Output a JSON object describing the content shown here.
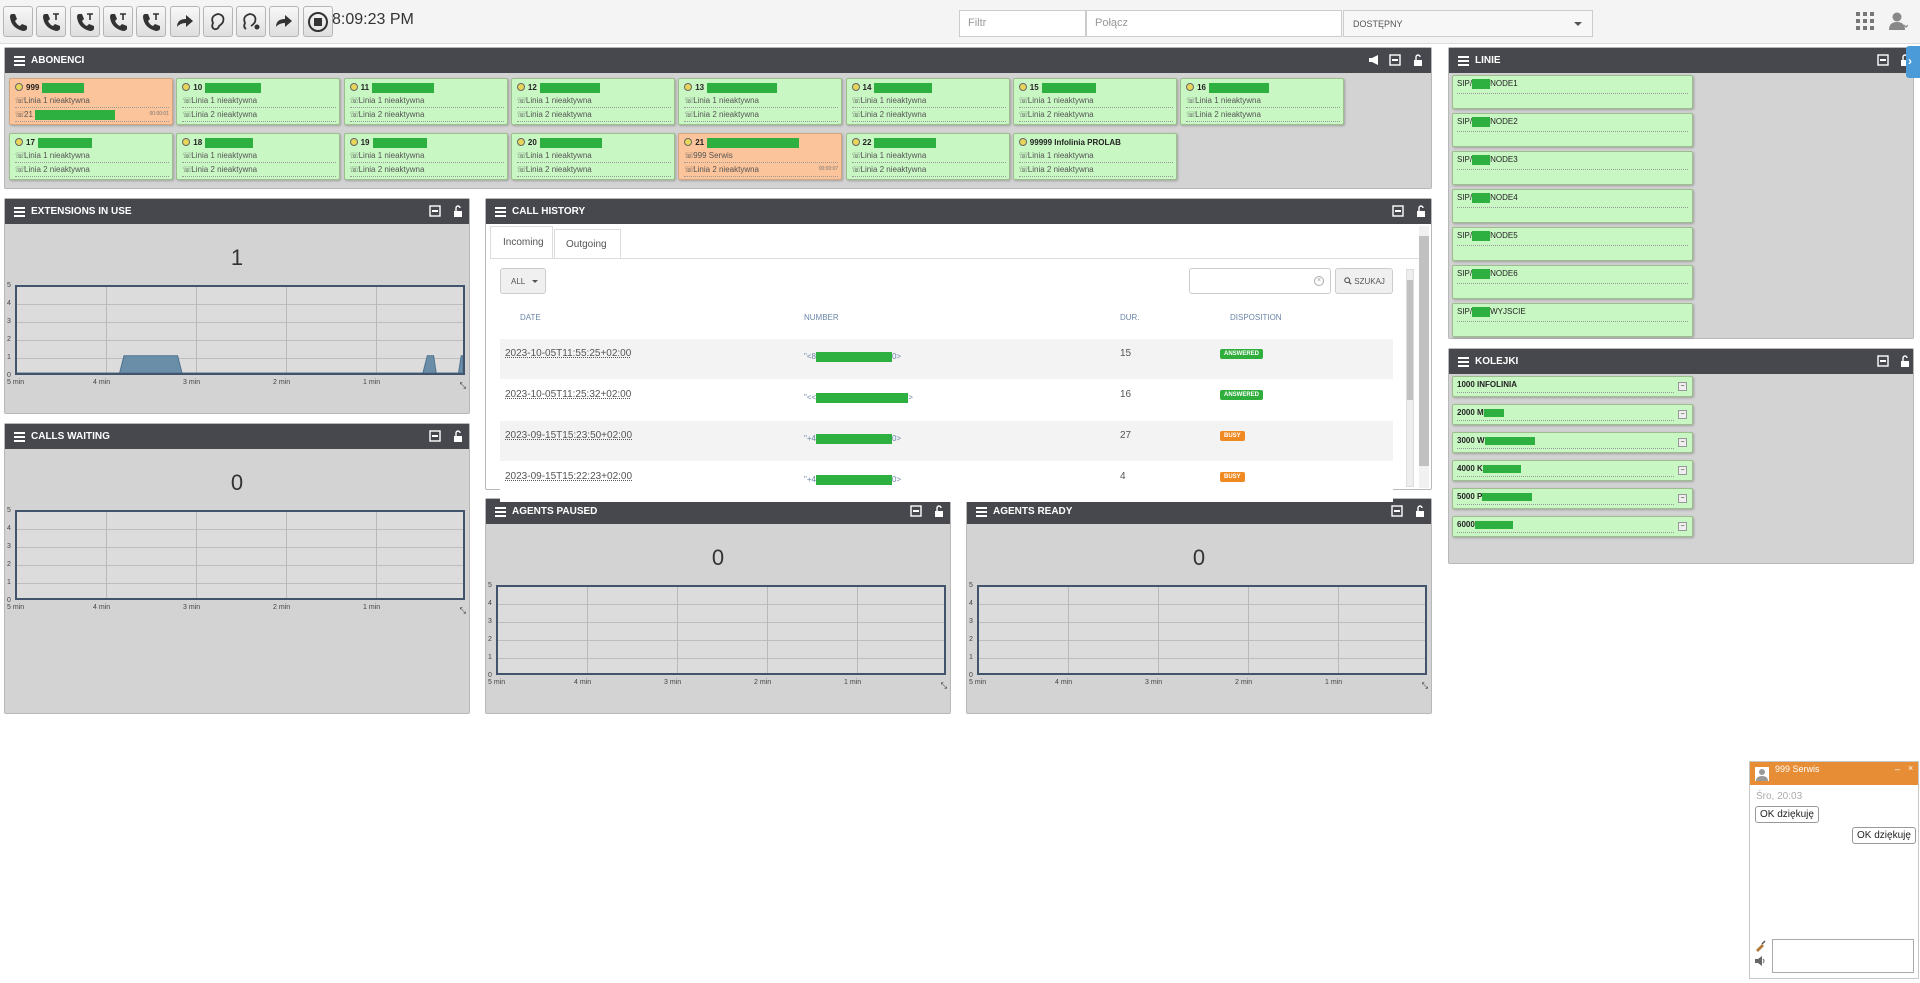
{
  "toolbar": {
    "clock": "8:09:23 PM",
    "filter_placeholder": "Filtr",
    "connect_placeholder": "Połącz",
    "status": "DOSTĘPNY",
    "buttons": [
      "phone-icon",
      "phone-transfer-icon",
      "phone-conference-icon",
      "phone-voicemail-icon",
      "phone-record-icon",
      "call-forward-icon",
      "ear-icon",
      "spy-icon",
      "call-redirect-icon",
      "stop-icon"
    ]
  },
  "abonenci": {
    "title": "ABONENCI",
    "cards": [
      {
        "num": "999",
        "line1": "Linia 1 nieaktywna",
        "line2": "21",
        "time": "00:00:01",
        "color": "orange",
        "r": 42,
        "r2": 80
      },
      {
        "num": "10",
        "line1": "Linia 1 nieaktywna",
        "line2": "Linia 2 nieaktywna",
        "color": "green",
        "r": 56
      },
      {
        "num": "11",
        "line1": "Linia 1 nieaktywna",
        "line2": "Linia 2 nieaktywna",
        "color": "green",
        "r": 62
      },
      {
        "num": "12",
        "line1": "Linia 1 nieaktywna",
        "line2": "Linia 2 nieaktywna",
        "color": "green",
        "r": 60
      },
      {
        "num": "13",
        "line1": "Linia 1 nieaktywna",
        "line2": "Linia 2 nieaktywna",
        "color": "green",
        "r": 70
      },
      {
        "num": "14",
        "line1": "Linia 1 nieaktywna",
        "line2": "Linia 2 nieaktywna",
        "color": "green",
        "r": 58
      },
      {
        "num": "15",
        "line1": "Linia 1 nieaktywna",
        "line2": "Linia 2 nieaktywna",
        "color": "green",
        "r": 54
      },
      {
        "num": "16",
        "line1": "Linia 1 nieaktywna",
        "line2": "Linia 2 nieaktywna",
        "color": "green",
        "r": 60
      },
      {
        "num": "17",
        "line1": "Linia 1 nieaktywna",
        "line2": "Linia 2 nieaktywna",
        "color": "green",
        "r": 54
      },
      {
        "num": "18",
        "line1": "Linia 1 nieaktywna",
        "line2": "Linia 2 nieaktywna",
        "color": "green",
        "r": 48
      },
      {
        "num": "19",
        "line1": "Linia 1 nieaktywna",
        "line2": "Linia 2 nieaktywna",
        "color": "green",
        "r": 54
      },
      {
        "num": "20",
        "line1": "Linia 1 nieaktywna",
        "line2": "Linia 2 nieaktywna",
        "color": "green",
        "r": 62
      },
      {
        "num": "21",
        "line1": "999 Serwis",
        "line2": "Linia 2 nieaktywna",
        "time": "00:00:07",
        "color": "orange",
        "r": 92
      },
      {
        "num": "22",
        "line1": "Linia 1 nieaktywna",
        "line2": "Linia 2 nieaktywna",
        "color": "green",
        "r": 62
      },
      {
        "num": "99999 Infolinia PROLAB",
        "line1": "Linia 1 nieaktywna",
        "line2": "Linia 2 nieaktywna",
        "color": "green",
        "r": 0
      }
    ]
  },
  "linie": {
    "title": "LINIE",
    "items": [
      {
        "a": "SIP/",
        "b": "NODE1"
      },
      {
        "a": "SIP/",
        "b": "NODE2"
      },
      {
        "a": "SIP/",
        "b": "NODE3"
      },
      {
        "a": "SIP/",
        "b": "NODE4"
      },
      {
        "a": "SIP/",
        "b": "NODE5"
      },
      {
        "a": "SIP/",
        "b": "NODE6"
      },
      {
        "a": "SIP/",
        "b": "WYJSCIE"
      }
    ]
  },
  "kolejki": {
    "title": "KOLEJKI",
    "items": [
      {
        "label": "1000 INFOLINIA",
        "r": 0
      },
      {
        "label": "2000 M",
        "r": 20
      },
      {
        "label": "3000 W",
        "r": 50
      },
      {
        "label": "4000 K",
        "r": 38
      },
      {
        "label": "5000 P",
        "r": 50
      },
      {
        "label": "6000",
        "r": 38
      }
    ]
  },
  "extensions": {
    "title": "EXTENSIONS IN USE",
    "value": "1"
  },
  "waiting": {
    "title": "CALLS WAITING",
    "value": "0"
  },
  "paused": {
    "title": "AGENTS PAUSED",
    "value": "0"
  },
  "ready": {
    "title": "AGENTS READY",
    "value": "0"
  },
  "chart_axes": {
    "y": [
      "5",
      "4",
      "3",
      "2",
      "1",
      "0"
    ],
    "x": [
      "5 min",
      "4 min",
      "3 min",
      "2 min",
      "1 min"
    ]
  },
  "chart_data": {
    "type": "area",
    "title": "",
    "xlabel": "",
    "ylabel": "",
    "ylim": [
      0,
      5
    ],
    "x_ticks": [
      "5 min",
      "4 min",
      "3 min",
      "2 min",
      "1 min"
    ],
    "x_range_min": [
      5,
      0
    ],
    "series": [
      {
        "points": [
          [
            5,
            0
          ],
          [
            3.85,
            0
          ],
          [
            3.8,
            1
          ],
          [
            3.2,
            1
          ],
          [
            3.15,
            0
          ],
          [
            0.45,
            0
          ],
          [
            0.4,
            1
          ],
          [
            0.33,
            1
          ],
          [
            0.3,
            0
          ],
          [
            0.05,
            0
          ],
          [
            0.02,
            1
          ],
          [
            0,
            1
          ]
        ]
      }
    ]
  },
  "history": {
    "title": "CALL HISTORY",
    "tabs": [
      "Incoming",
      "Outgoing"
    ],
    "filter": "ALL",
    "search_btn": "SZUKAJ",
    "cols": [
      "DATE",
      "NUMBER",
      "DUR.",
      "DISPOSITION"
    ],
    "rows": [
      {
        "date": "2023-10-05T11:55:25+02:00",
        "n1": "\"<8",
        "n2": "0>",
        "dur": "15",
        "disp": "ANSWERED",
        "color": "#2fae3c"
      },
      {
        "date": "2023-10-05T11:25:32+02:00",
        "n1": "\"<<",
        "n2": ">",
        "dur": "16",
        "disp": "ANSWERED",
        "color": "#2fae3c"
      },
      {
        "date": "2023-09-15T15:23:50+02:00",
        "n1": "\"+4",
        "n2": "0>",
        "dur": "27",
        "disp": "BUSY",
        "color": "#ef8a22"
      },
      {
        "date": "2023-09-15T15:22:23+02:00",
        "n1": "\"+4",
        "n2": "0>",
        "dur": "4",
        "disp": "BUSY",
        "color": "#ef8a22"
      }
    ]
  },
  "chat": {
    "name": "999 Serwis",
    "date": "Śro, 20:03",
    "msg_in": "OK dziękuję",
    "msg_out": "OK dziękuję"
  }
}
